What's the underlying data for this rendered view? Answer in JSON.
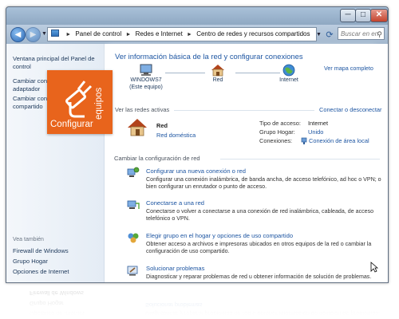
{
  "titlebar": {
    "min_label": "─",
    "max_label": "□",
    "close_label": "✕"
  },
  "navigation": {
    "back_icon": "arrow-left-icon",
    "forward_icon": "arrow-right-icon",
    "breadcrumb": [
      "Panel de control",
      "Redes e Internet",
      "Centro de redes y recursos compartidos"
    ],
    "separator": "►",
    "refresh_icon": "refresh-icon",
    "search_placeholder": "Buscar en en"
  },
  "sidebar": {
    "items": [
      "Ventana principal del Panel de control",
      "Cambiar configuración del adaptador",
      "Cambiar configuración de uso compartido"
    ],
    "see_also_label": "Vea también",
    "see_also": [
      "Firewall de Windows",
      "Grupo Hogar",
      "Opciones de Internet"
    ]
  },
  "logo": {
    "main_text": "Configurar",
    "vertical_text": "equipos",
    "color": "#e8641c"
  },
  "header": {
    "title": "Ver información básica de la red y configurar conexiones",
    "full_map_link": "Ver mapa completo",
    "nodes": [
      {
        "label": "WINDOWS7",
        "sublabel": "(Este equipo)",
        "icon": "computer-icon"
      },
      {
        "label": "Red",
        "sublabel": "",
        "icon": "house-icon"
      },
      {
        "label": "Internet",
        "sublabel": "",
        "icon": "globe-icon"
      }
    ]
  },
  "active_networks": {
    "label": "Ver las redes activas",
    "connect_link": "Conectar o desconectar",
    "network_name": "Red",
    "network_type": "Red doméstica",
    "properties": [
      {
        "key": "Tipo de acceso:",
        "value": "Internet",
        "link": false
      },
      {
        "key": "Grupo Hogar:",
        "value": "Unido",
        "link": true
      },
      {
        "key": "Conexiones:",
        "value": "Conexión de área local",
        "link": true
      }
    ]
  },
  "change_settings": {
    "label": "Cambiar la configuración de red",
    "tasks": [
      {
        "title": "Configurar una nueva conexión o red",
        "desc": [
          "Configurar una conexión inalámbrica, de banda ancha, de acceso telefónico, ad hoc o VPN; o",
          "bien configurar un enrutador o punto de acceso."
        ]
      },
      {
        "title": "Conectarse a una red",
        "desc": [
          "Conectarse o volver a conectarse a una conexión de red inalámbrica, cableada, de acceso",
          "telefónico o VPN."
        ]
      },
      {
        "title": "Elegir grupo en el hogar y opciones de uso compartido",
        "desc": [
          "Obtener acceso a archivos e impresoras ubicados en otros equipos de la red o cambiar la",
          "configuración de uso compartido."
        ]
      },
      {
        "title": "Solucionar problemas",
        "desc": [
          "Diagnosticar y reparar problemas de red u obtener información de solución de problemas."
        ]
      }
    ]
  }
}
